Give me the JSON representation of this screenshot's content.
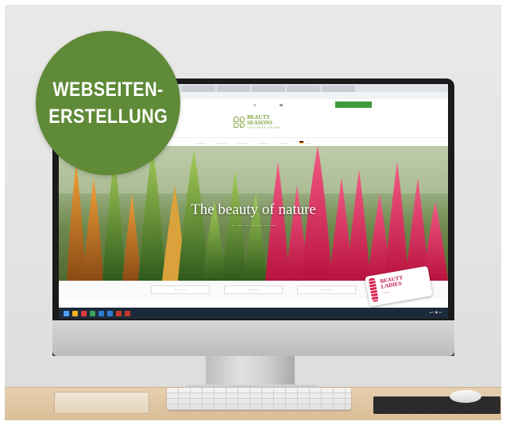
{
  "badge": {
    "line1": "WEBSEITEN-",
    "line2": "ERSTELLUNG",
    "color": "#5f8a37"
  },
  "website": {
    "logo_line1": "BEAUTY",
    "logo_line2": "SEASONS",
    "logo_sub": "NORTHERN·GROWN",
    "hero_title": "The beauty of nature",
    "accent": "#3e9a3a"
  },
  "product_badge": {
    "line1": "BEAUTY",
    "line2": "LADIES",
    "color": "#c4124a"
  }
}
